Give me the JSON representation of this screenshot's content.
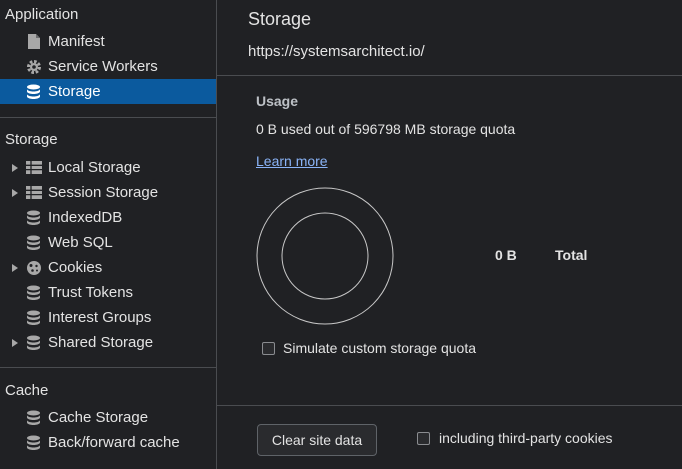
{
  "sidebar": {
    "application": {
      "title": "Application",
      "items": [
        {
          "label": "Manifest",
          "icon": "document-icon"
        },
        {
          "label": "Service Workers",
          "icon": "gear-icon"
        },
        {
          "label": "Storage",
          "icon": "database-icon",
          "selected": true
        }
      ]
    },
    "storage": {
      "title": "Storage",
      "items": [
        {
          "label": "Local Storage",
          "icon": "grid-icon",
          "expandable": true
        },
        {
          "label": "Session Storage",
          "icon": "grid-icon",
          "expandable": true
        },
        {
          "label": "IndexedDB",
          "icon": "database-icon"
        },
        {
          "label": "Web SQL",
          "icon": "database-icon"
        },
        {
          "label": "Cookies",
          "icon": "cookie-icon",
          "expandable": true
        },
        {
          "label": "Trust Tokens",
          "icon": "database-icon"
        },
        {
          "label": "Interest Groups",
          "icon": "database-icon"
        },
        {
          "label": "Shared Storage",
          "icon": "database-icon",
          "expandable": true
        }
      ]
    },
    "cache": {
      "title": "Cache",
      "items": [
        {
          "label": "Cache Storage",
          "icon": "database-icon"
        },
        {
          "label": "Back/forward cache",
          "icon": "database-icon"
        }
      ]
    }
  },
  "main": {
    "title": "Storage",
    "origin": "https://systemsarchitect.io/",
    "usage": {
      "heading": "Usage",
      "summary": "0 B used out of 596798 MB storage quota",
      "learn_more": "Learn more",
      "total_value": "0 B",
      "total_label": "Total"
    },
    "simulate_quota_label": "Simulate custom storage quota",
    "clear_button": "Clear site data",
    "third_party_label": "including third-party cookies"
  },
  "colors": {
    "background": "#202124",
    "selected": "#0b5a9e",
    "link": "#8ab4f8",
    "text": "#e3e3e3",
    "muted": "#bdc1c6"
  }
}
